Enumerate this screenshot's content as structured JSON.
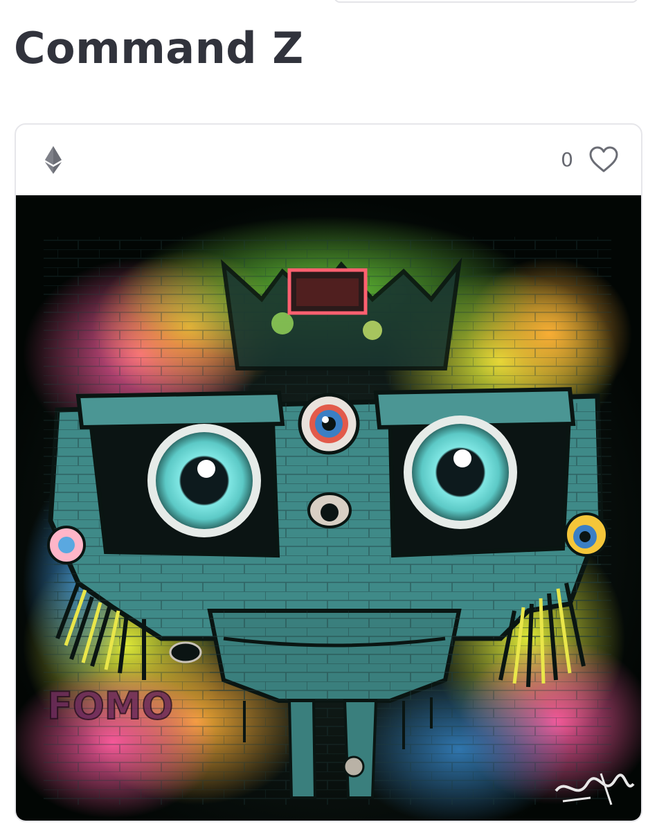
{
  "page": {
    "title": "Command Z"
  },
  "card": {
    "currency_icon": "ethereum-icon",
    "like_count": "0",
    "like_icon": "heart-outline-icon",
    "artwork": {
      "kind": "graffiti robot face mural",
      "tag_text": "FOMO"
    }
  },
  "colors": {
    "title_text": "#31333c",
    "icon_gray": "#6b6d75",
    "card_border": "#e6e6ea"
  }
}
